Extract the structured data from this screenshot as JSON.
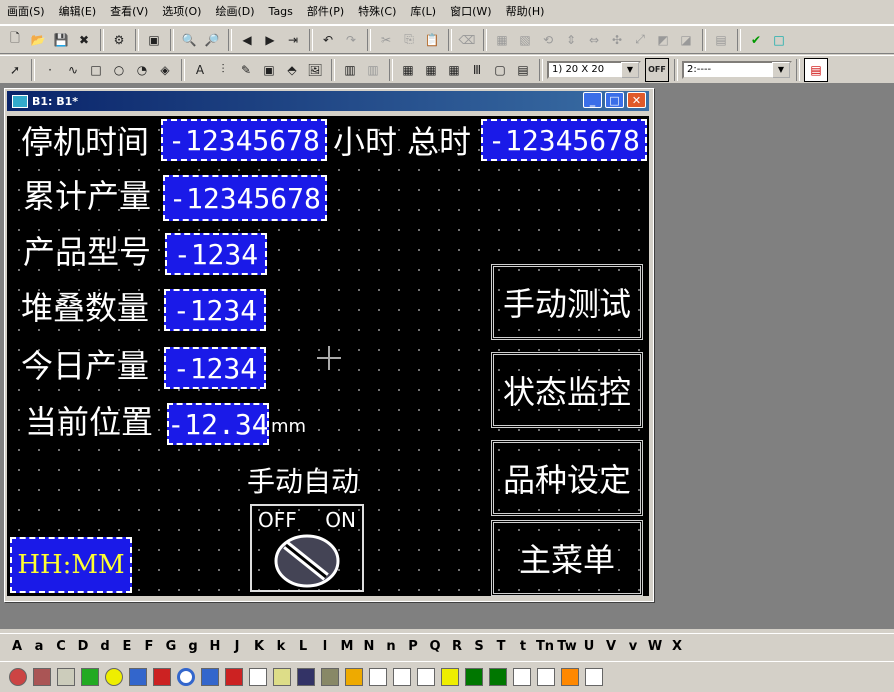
{
  "menu": [
    "画面(S)",
    "编辑(E)",
    "查看(V)",
    "选项(O)",
    "绘画(D)",
    "Tags",
    "部件(P)",
    "特殊(C)",
    "库(L)",
    "窗口(W)",
    "帮助(H)"
  ],
  "toolbar": {
    "grid_select": "1) 20 X 20",
    "state_select": "2:----",
    "off_label": "OFF"
  },
  "window": {
    "title": "B1:  B1*"
  },
  "screen": {
    "labels": {
      "downtime": "停机时间",
      "hours": "小时",
      "total": "总时",
      "output_total": "累计产量",
      "model": "产品型号",
      "stack": "堆叠数量",
      "today": "今日产量",
      "position": "当前位置",
      "mm": "mm",
      "manual_auto": "手动自动"
    },
    "values": {
      "downtime": "-12345678",
      "total": "-12345678",
      "output_total": "-12345678",
      "model": "-1234",
      "stack": "-1234",
      "today": "-1234",
      "position": "-12.34"
    },
    "buttons": {
      "manual_test": "手动测试",
      "status_monitor": "状态监控",
      "variety_setting": "品种设定",
      "main_menu": "主菜单"
    },
    "switch": {
      "off": "OFF",
      "on": "ON"
    },
    "clock": "HH:MM"
  },
  "letters": [
    "A",
    "a",
    "C",
    "D",
    "d",
    "E",
    "F",
    "G",
    "g",
    "H",
    "J",
    "K",
    "k",
    "L",
    "l",
    "M",
    "N",
    "n",
    "P",
    "Q",
    "R",
    "S",
    "T",
    "t",
    "Tn",
    "Tw",
    "U",
    "V",
    "v",
    "W",
    "X"
  ]
}
